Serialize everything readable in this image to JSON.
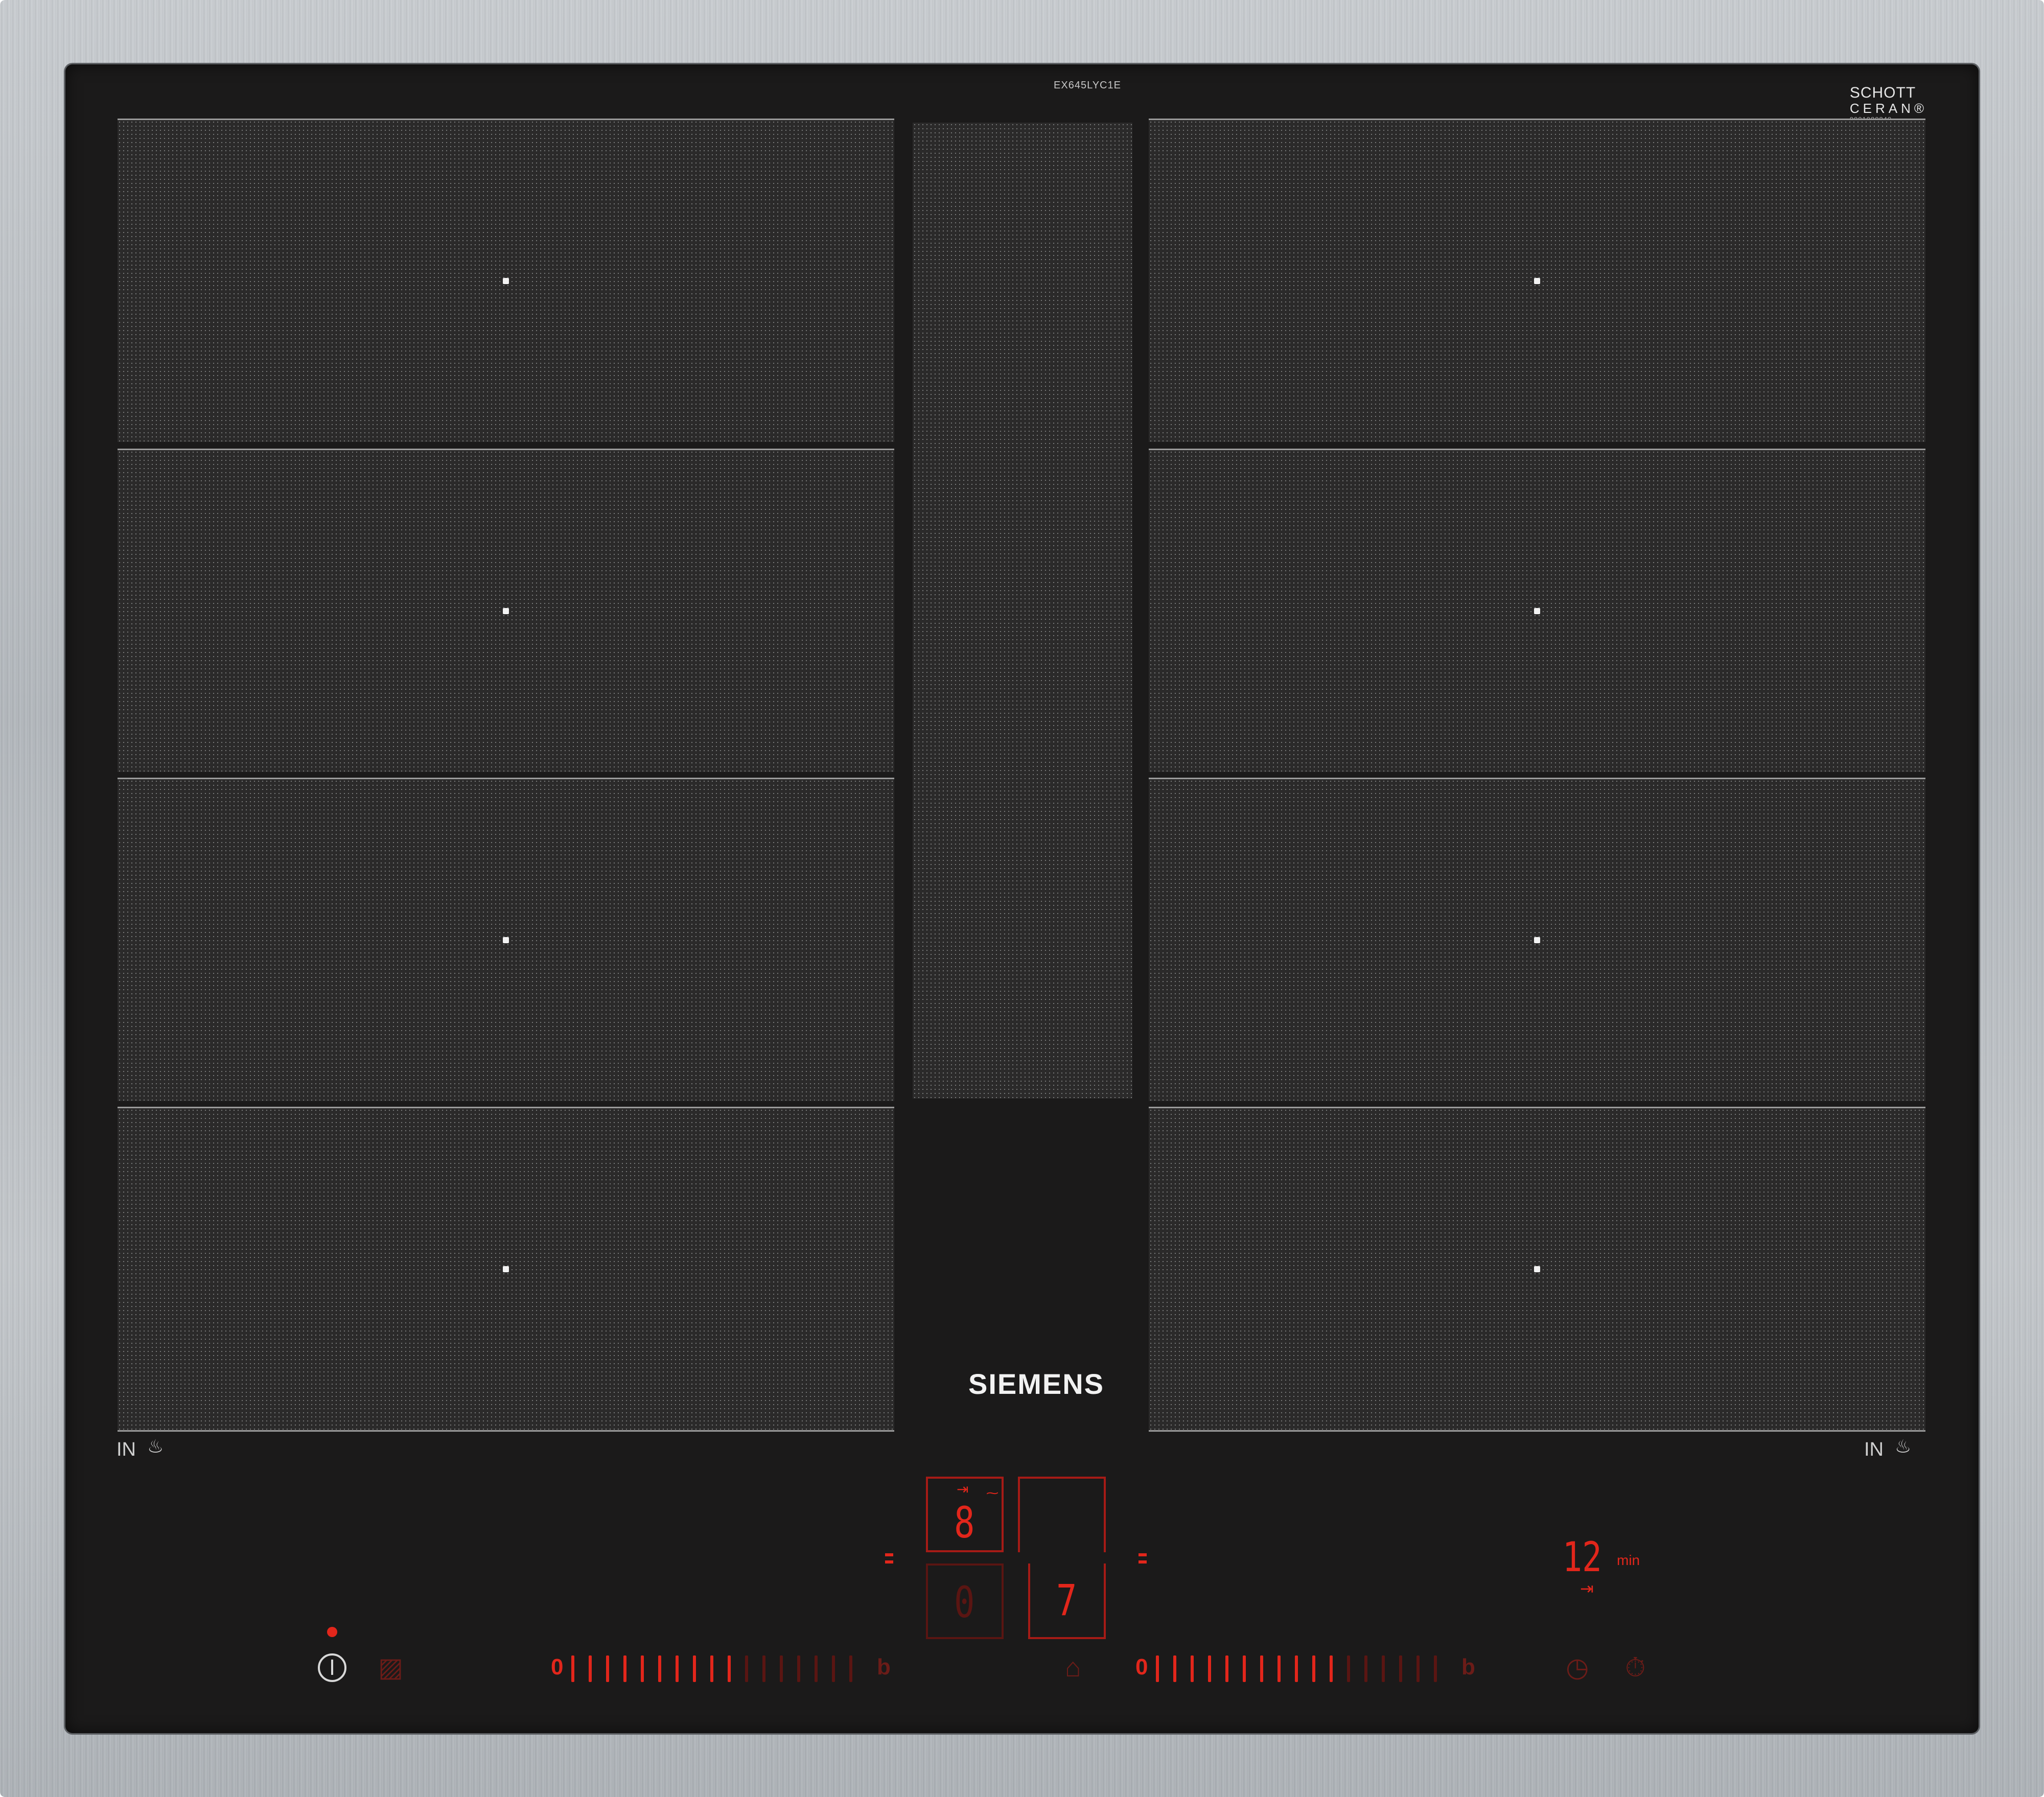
{
  "model_code": "EX645LYC1E",
  "schott_logo": {
    "line1": "SCHOTT",
    "line2": "CERAN®",
    "serial": "9001080840"
  },
  "brand": "SIEMENS",
  "zones": {
    "left": {
      "in_label": "IN",
      "pan_icon": "pan-icon"
    },
    "right": {
      "in_label": "IN",
      "pan_icon": "pan-icon"
    }
  },
  "displays": {
    "top_left_value": "8",
    "bottom_left_value": "0",
    "bottom_right_value": "7",
    "top_left_timer_icon": "⇥",
    "top_left_extra_icon": "⁓"
  },
  "timer": {
    "value": "12",
    "unit": "min",
    "icon": "⇥"
  },
  "sliders": {
    "left": {
      "start_label": "0",
      "end_label": "b",
      "level": 0.6
    },
    "right": {
      "start_label": "0",
      "end_label": "b",
      "level": 0.62
    }
  },
  "controls": {
    "power_icon": "power-icon",
    "power_indicator_color": "#e2261b",
    "childlock_icon": "wipe-protection-icon",
    "keep_warm_icon": "keep-warm-icon",
    "clock_icon": "clock-icon",
    "stopwatch_icon": "stopwatch-icon"
  },
  "colors": {
    "glass": "#1b1a1a",
    "led_red": "#e2261b",
    "led_dim": "#5a1512",
    "frame": "#b8bcc0"
  }
}
